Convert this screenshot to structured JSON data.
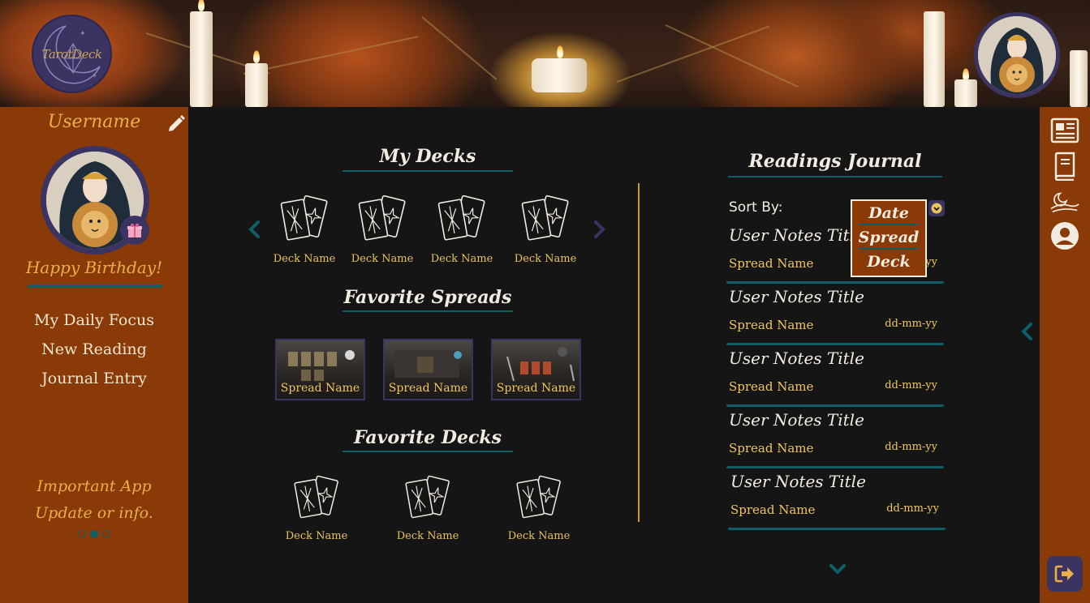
{
  "app": {
    "logo_text": "TarotDeck"
  },
  "sidebar": {
    "username": "Username",
    "greeting": "Happy Birthday!",
    "nav": [
      {
        "label": "My Daily Focus"
      },
      {
        "label": "New Reading"
      },
      {
        "label": "Journal Entry"
      }
    ],
    "info_line1": "Important App",
    "info_line2": "Update or info.",
    "carousel": {
      "count": 3,
      "active": 2
    }
  },
  "my_decks": {
    "title": "My Decks",
    "items": [
      {
        "label": "Deck Name"
      },
      {
        "label": "Deck Name"
      },
      {
        "label": "Deck Name"
      },
      {
        "label": "Deck Name"
      }
    ]
  },
  "favorite_spreads": {
    "title": "Favorite Spreads",
    "items": [
      {
        "label": "Spread Name"
      },
      {
        "label": "Spread Name"
      },
      {
        "label": "Spread Name"
      }
    ]
  },
  "favorite_decks": {
    "title": "Favorite Decks",
    "items": [
      {
        "label": "Deck Name"
      },
      {
        "label": "Deck Name"
      },
      {
        "label": "Deck Name"
      }
    ]
  },
  "journal": {
    "title": "Readings Journal",
    "sort_label": "Sort By:",
    "sort_options": [
      "Date",
      "Spread",
      "Deck"
    ],
    "entries": [
      {
        "title": "User Notes Title",
        "spread": "Spread Name",
        "date": "dd-mm-yy"
      },
      {
        "title": "User Notes Title",
        "spread": "Spread Name",
        "date": "dd-mm-yy"
      },
      {
        "title": "User Notes Title",
        "spread": "Spread Name",
        "date": "dd-mm-yy"
      },
      {
        "title": "User Notes Title",
        "spread": "Spread Name",
        "date": "dd-mm-yy"
      },
      {
        "title": "User Notes Title",
        "spread": "Spread Name",
        "date": "dd-mm-yy"
      }
    ]
  },
  "icons": {
    "edit": "pencil-icon",
    "rail": [
      "newspaper-icon",
      "book-icon",
      "hand-moon-icon",
      "user-circle-icon"
    ],
    "logout": "logout-icon",
    "prev": "chevron-left-icon",
    "next": "chevron-right-icon",
    "scroll_down": "chevron-down-icon"
  },
  "colors": {
    "sidebar_bg": "#8a3a06",
    "main_bg": "#151515",
    "accent_gold": "#e8c25a",
    "accent_teal": "#0f5e66",
    "badge_purple": "#3b3362"
  }
}
